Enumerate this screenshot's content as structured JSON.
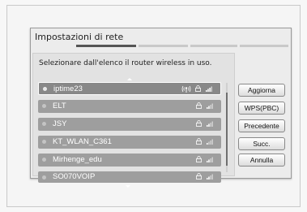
{
  "dialog": {
    "title": "Impostazioni di rete",
    "instruction": "Selezionare dall'elenco il router wireless in uso."
  },
  "networks": [
    {
      "name": "iptime23",
      "selected": true,
      "wps": true
    },
    {
      "name": "ELT"
    },
    {
      "name": "JSY"
    },
    {
      "name": "KT_WLAN_C361"
    },
    {
      "name": "Mirhenge_edu"
    },
    {
      "name": "SO070VOIP"
    }
  ],
  "buttons": {
    "aggiorna": "Aggiorna",
    "wps": "WPS(PBC)",
    "precedente": "Precedente",
    "succ": "Succ.",
    "annulla": "Annulla"
  },
  "icons": {
    "lock": "lock-icon",
    "signal": "wifi-signal-icon",
    "wps": "wps-icon",
    "scroll_up": "arrow-up-icon",
    "scroll_down": "arrow-down-icon"
  }
}
